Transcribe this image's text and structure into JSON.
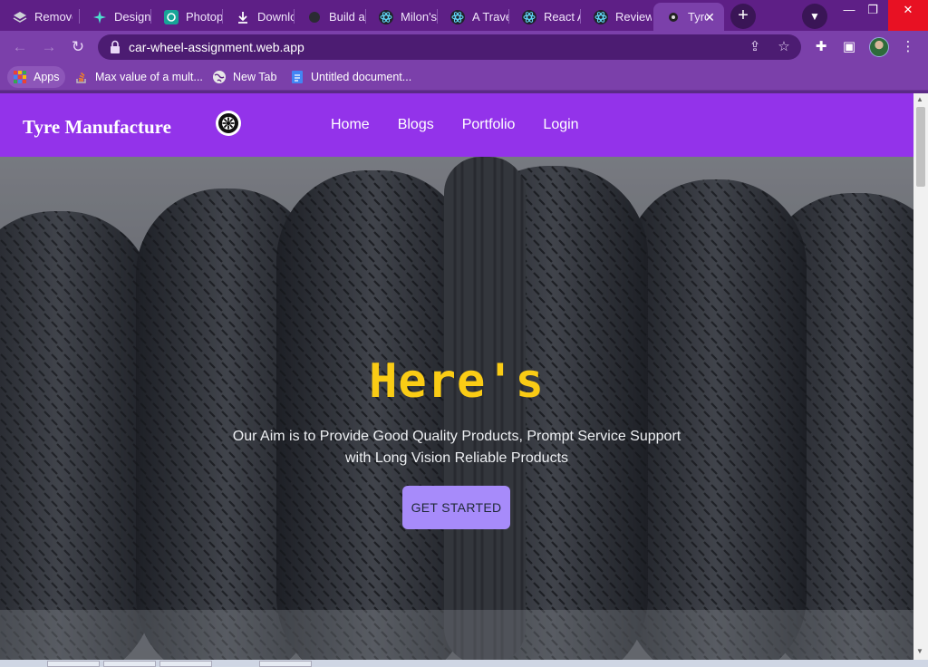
{
  "browser": {
    "tabs": [
      {
        "label": "Remove",
        "icon": "layers-icon"
      },
      {
        "label": "Designi",
        "icon": "sparkle-icon"
      },
      {
        "label": "Photop",
        "icon": "photopea-icon"
      },
      {
        "label": "Downlo",
        "icon": "download-icon"
      },
      {
        "label": "Build a",
        "icon": "github-icon"
      },
      {
        "label": "Milon's",
        "icon": "react-icon"
      },
      {
        "label": "A Trave",
        "icon": "react-icon"
      },
      {
        "label": "React A",
        "icon": "react-icon"
      },
      {
        "label": "Review",
        "icon": "react-icon"
      },
      {
        "label": "Tyre",
        "icon": "tyre-icon",
        "active": true
      }
    ],
    "url": "car-wheel-assignment.web.app",
    "bookmarks": [
      {
        "label": "Apps",
        "icon": "apps-grid-icon"
      },
      {
        "label": "Max value of a mult...",
        "icon": "stackoverflow-icon"
      },
      {
        "label": "New Tab",
        "icon": "globe-icon"
      },
      {
        "label": "Untitled document...",
        "icon": "docs-icon"
      }
    ],
    "colors": {
      "frame": "#5e1f86",
      "toolbar": "#7b40aa"
    }
  },
  "site": {
    "brand": "Tyre Manufacture",
    "nav": [
      "Home",
      "Blogs",
      "Portfolio",
      "Login"
    ],
    "hero": {
      "title": "Here's",
      "text": "Our Aim is to Provide Good Quality Products, Prompt Service Support with Long Vision Reliable Products",
      "button": "GET STARTED"
    },
    "colors": {
      "navbar": "#9333ea",
      "title": "#facc15",
      "button": "#a78bfa"
    }
  }
}
